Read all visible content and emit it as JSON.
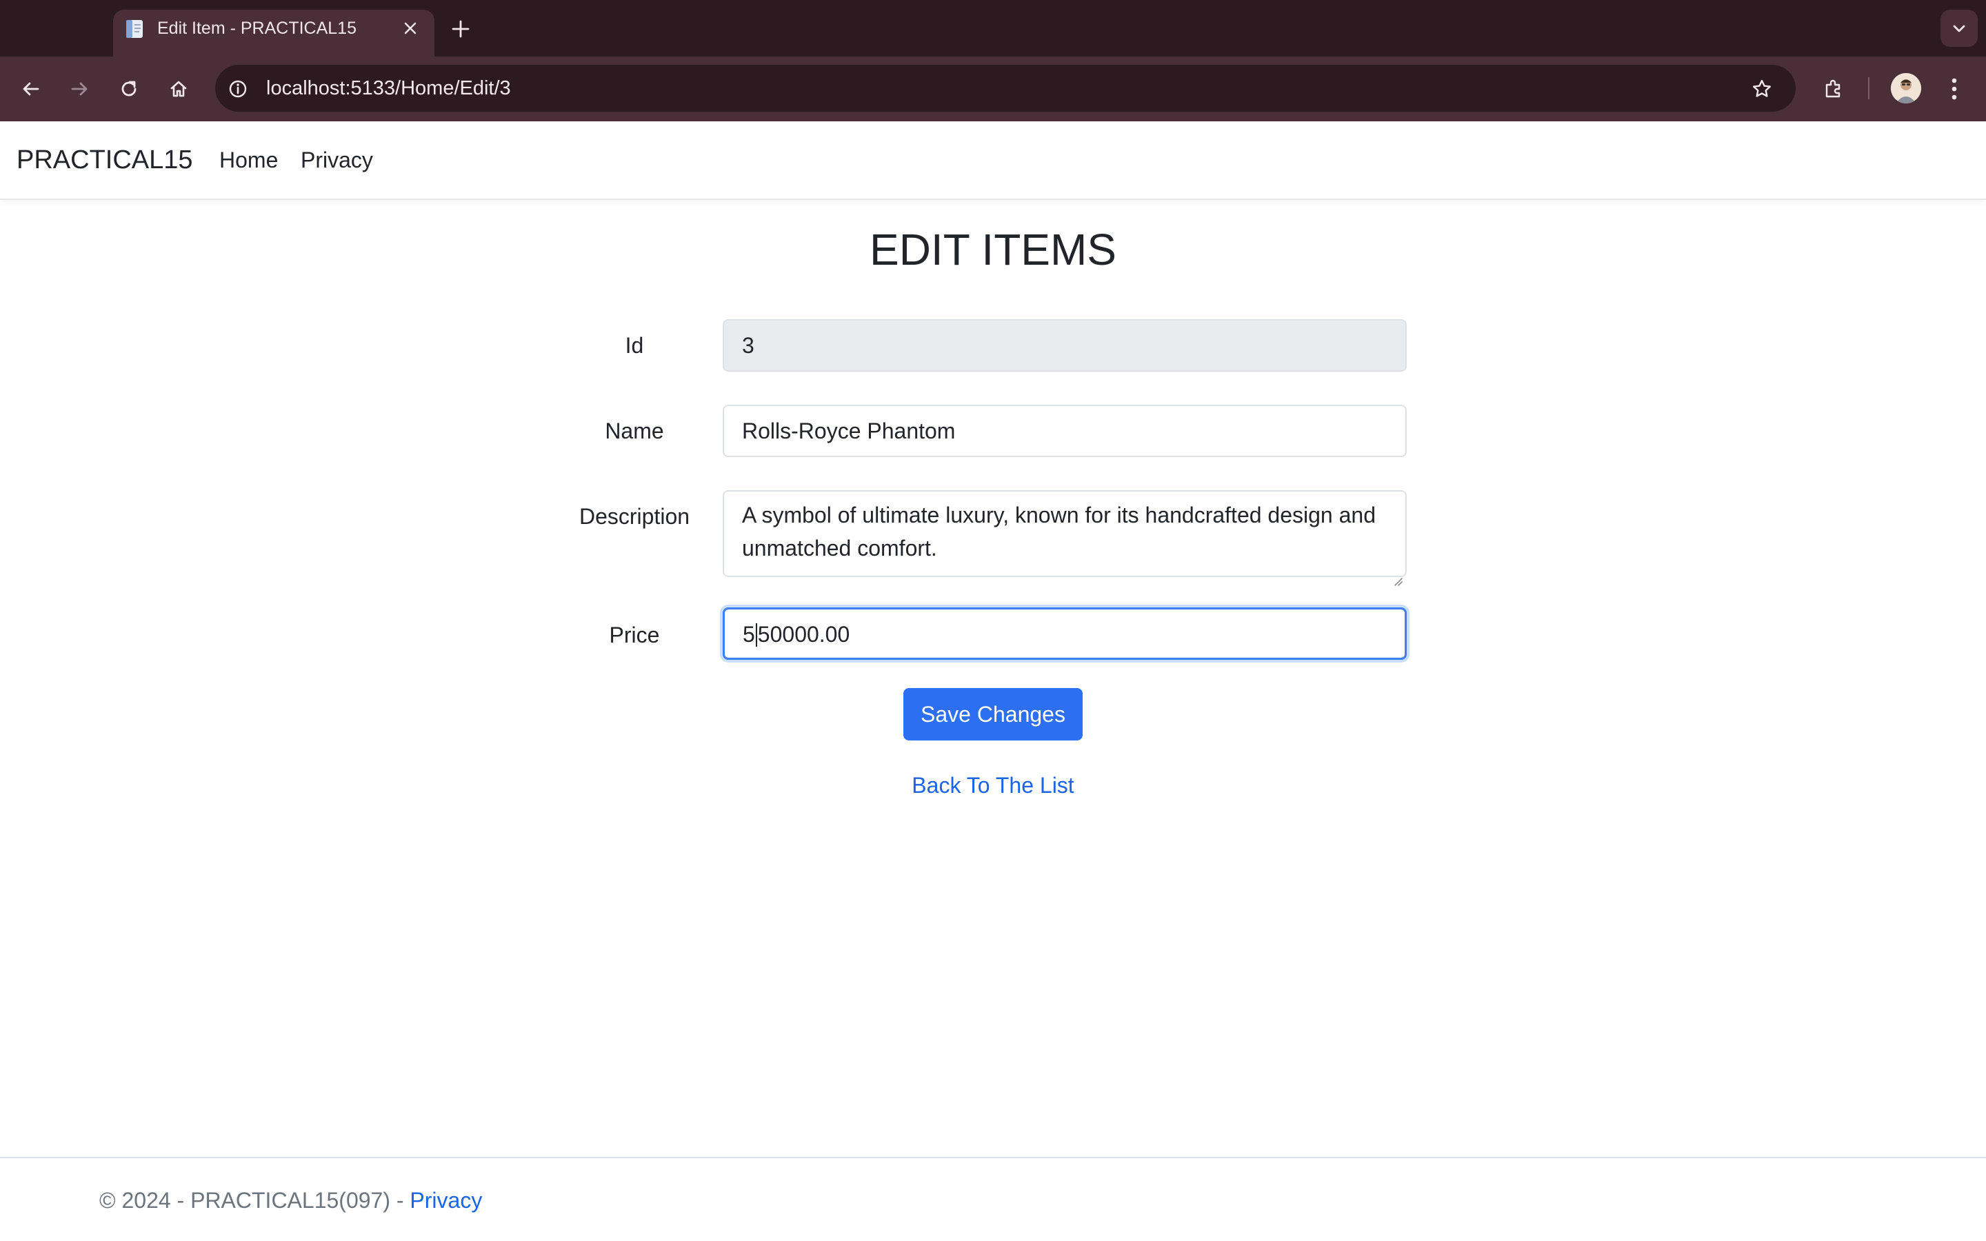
{
  "browser": {
    "tab_title": "Edit Item - PRACTICAL15",
    "url": "localhost:5133/Home/Edit/3"
  },
  "navbar": {
    "brand": "PRACTICAL15",
    "links": [
      "Home",
      "Privacy"
    ]
  },
  "form": {
    "title": "EDIT ITEMS",
    "fields": {
      "id": {
        "label": "Id",
        "value": "3"
      },
      "name": {
        "label": "Name",
        "value": "Rolls-Royce Phantom"
      },
      "description": {
        "label": "Description",
        "value": "A symbol of ultimate luxury, known for its handcrafted design and unmatched comfort."
      },
      "price": {
        "label": "Price",
        "value_before_caret": "5",
        "value_after_caret": "50000.00"
      }
    },
    "submit_label": "Save Changes",
    "back_label": "Back To The List"
  },
  "footer": {
    "text": "© 2024 - PRACTICAL15(097) - ",
    "link": "Privacy"
  },
  "colors": {
    "chrome_dark": "#2d1a20",
    "chrome_toolbar": "#4a2f38",
    "primary": "#2d6ff2",
    "link": "#1a64e8",
    "focus_border": "#3d7df6"
  }
}
